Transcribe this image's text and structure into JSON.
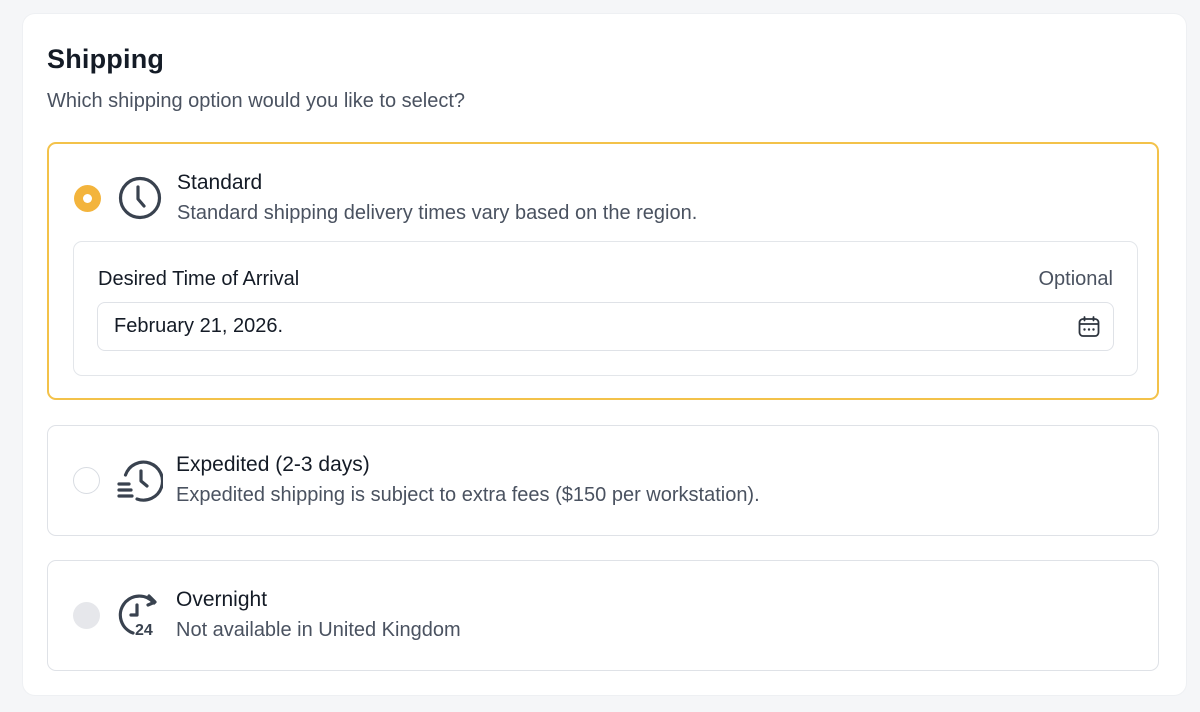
{
  "header": {
    "title": "Shipping",
    "subtitle": "Which shipping option would you like to select?"
  },
  "options": [
    {
      "title": "Standard",
      "description": "Standard shipping delivery times vary based on the region.",
      "selected": true,
      "icon": "clock-icon",
      "date_field": {
        "label": "Desired Time of Arrival",
        "optional_label": "Optional",
        "value": "February 21, 2026.",
        "icon": "calendar-icon"
      }
    },
    {
      "title": "Expedited (2-3 days)",
      "description": "Expedited shipping is subject to extra fees ($150 per workstation).",
      "selected": false,
      "icon": "fast-clock-icon"
    },
    {
      "title": "Overnight",
      "description": "Not available in United Kingdom",
      "selected": false,
      "disabled": true,
      "icon": "24-hour-icon"
    }
  ],
  "colors": {
    "accent": "#f3b43c",
    "selected_border": "#f3c24a",
    "border": "#dfe2e7",
    "text": "#141b26",
    "muted_text": "#4a5260"
  }
}
